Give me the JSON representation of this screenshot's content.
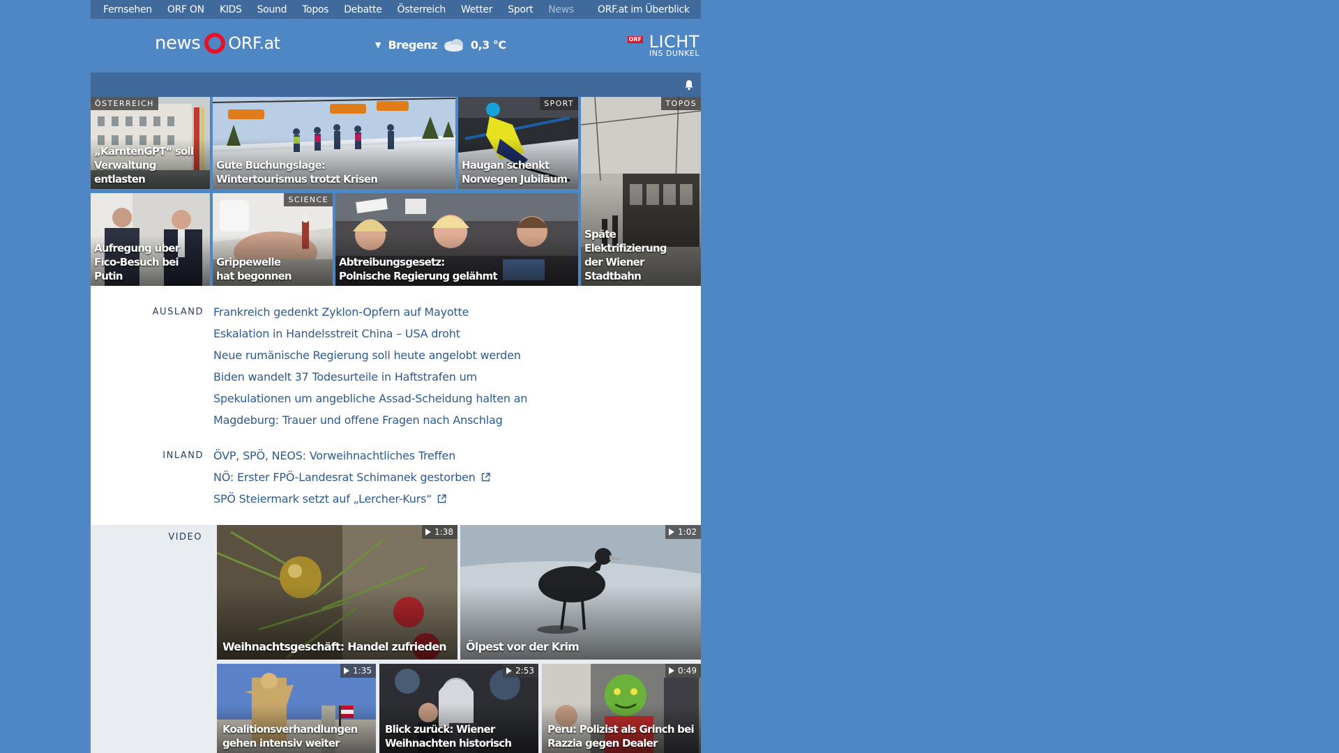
{
  "topnav": {
    "items": [
      "Fernsehen",
      "ORF ON",
      "KIDS",
      "Sound",
      "Topos",
      "Debatte",
      "Österreich",
      "Wetter",
      "Sport",
      "News"
    ],
    "overview": "ORF.at im Überblick"
  },
  "header": {
    "logo_news": "news",
    "logo_orf": "ORF.at",
    "weather": {
      "location": "Bregenz",
      "temperature": "0,3 °C",
      "icon": "cloudy-icon"
    },
    "licht": {
      "orf_badge": "ORF",
      "title": "LICHT",
      "subtitle": "INS DUNKEL"
    }
  },
  "teasers": [
    {
      "tag": "ÖSTERREICH",
      "title": "„KärntenGPT“ soll\nVerwaltung entlasten"
    },
    {
      "tag": "",
      "title": "Gute Buchungslage:\nWintertourismus trotzt Krisen"
    },
    {
      "tag": "SPORT",
      "title": "Haugan schenkt\nNorwegen Jubiläum"
    },
    {
      "tag": "TOPOS",
      "title": "Späte Elektrifizierung\nder Wiener Stadtbahn"
    },
    {
      "tag": "",
      "title": "Aufregung über\nFico-Besuch bei Putin"
    },
    {
      "tag": "SCIENCE",
      "title": "Grippewelle\nhat begonnen"
    },
    {
      "tag": "",
      "title": "Abtreibungsgesetz:\nPolnische Regierung gelähmt"
    }
  ],
  "ausland": {
    "label": "AUSLAND",
    "items": [
      "Frankreich gedenkt Zyklon-Opfern auf Mayotte",
      "Eskalation in Handelsstreit China – USA droht",
      "Neue rumänische Regierung soll heute angelobt werden",
      "Biden wandelt 37 Todesurteile in Haftstrafen um",
      "Spekulationen um angebliche Assad-Scheidung halten an",
      "Magdeburg: Trauer und offene Fragen nach Anschlag"
    ]
  },
  "inland": {
    "label": "INLAND",
    "items": [
      "ÖVP, SPÖ, NEOS: Vorweihnachtliches Treffen",
      "NÖ: Erster FPÖ-Landesrat Schimanek gestorben",
      "SPÖ Steiermark setzt auf „Lercher-Kurs“"
    ]
  },
  "video": {
    "label": "VIDEO",
    "items": [
      {
        "duration": "1:38",
        "title": "Weihnachtsgeschäft: Handel zufrieden"
      },
      {
        "duration": "1:02",
        "title": "Ölpest vor der Krim"
      },
      {
        "duration": "1:35",
        "title": "Koalitionsverhandlungen\ngehen intensiv weiter"
      },
      {
        "duration": "2:53",
        "title": "Blick zurück: Wiener\nWeihnachten historisch"
      },
      {
        "duration": "0:49",
        "title": "Peru: Polizist als Grinch bei\nRazzia gegen Dealer"
      }
    ]
  }
}
